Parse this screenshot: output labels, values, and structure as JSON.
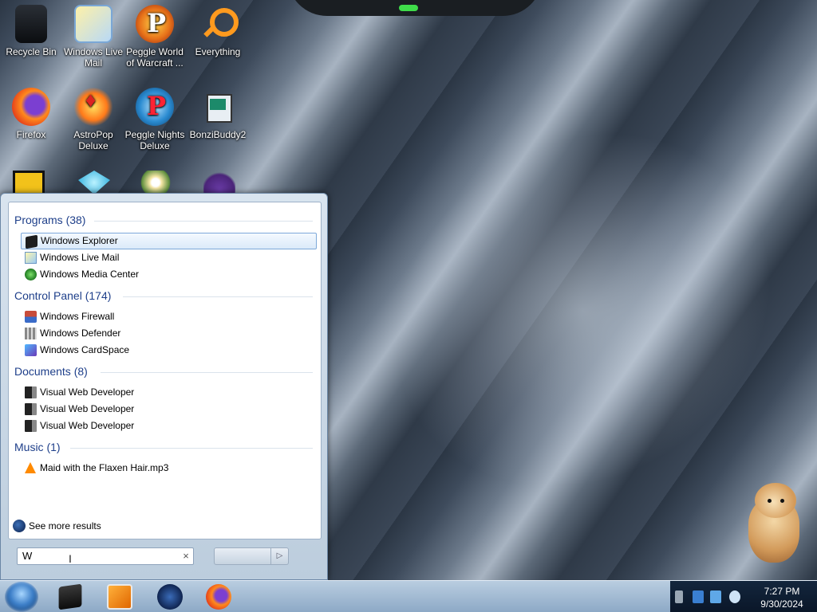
{
  "desktop": {
    "icons": [
      {
        "label": "Recycle Bin",
        "icon": "recycle-bin-icon"
      },
      {
        "label": "Windows Live Mail",
        "icon": "windows-live-mail-icon"
      },
      {
        "label": "Peggle World of Warcraft ...",
        "icon": "peggle-icon"
      },
      {
        "label": "Everything",
        "icon": "magnifier-icon"
      },
      {
        "label": "Firefox",
        "icon": "firefox-icon"
      },
      {
        "label": "AstroPop Deluxe",
        "icon": "astropop-icon"
      },
      {
        "label": "Peggle Nights Deluxe",
        "icon": "peggle-nights-icon"
      },
      {
        "label": "BonziBuddy2",
        "icon": "bonzibuddy-icon"
      }
    ]
  },
  "start_menu": {
    "groups": [
      {
        "title": "Programs (38)",
        "items": [
          {
            "label": "Windows Explorer",
            "icon": "windows-explorer-icon",
            "selected": true
          },
          {
            "label": "Windows Live Mail",
            "icon": "windows-live-mail-icon"
          },
          {
            "label": "Windows Media Center",
            "icon": "windows-media-center-icon"
          }
        ]
      },
      {
        "title": "Control Panel (174)",
        "items": [
          {
            "label": "Windows Firewall",
            "icon": "firewall-icon"
          },
          {
            "label": "Windows Defender",
            "icon": "defender-icon"
          },
          {
            "label": "Windows CardSpace",
            "icon": "cardspace-icon"
          }
        ]
      },
      {
        "title": "Documents (8)",
        "items": [
          {
            "label": "Visual Web Developer",
            "icon": "visual-web-developer-icon"
          },
          {
            "label": "Visual Web Developer",
            "icon": "visual-web-developer-icon"
          },
          {
            "label": "Visual Web Developer",
            "icon": "visual-web-developer-icon"
          }
        ]
      },
      {
        "title": "Music (1)",
        "items": [
          {
            "label": "Maid with the Flaxen Hair.mp3",
            "icon": "vlc-icon"
          }
        ]
      }
    ],
    "see_more": "See more results",
    "search": {
      "value": "W",
      "clear": "×"
    },
    "shutdown_arrow": "▷"
  },
  "taskbar": {
    "apps": [
      "windows-explorer-icon",
      "windows-media-player-icon",
      "bonzibuddy-icon",
      "firefox-icon"
    ],
    "clock": {
      "time": "7:27 PM",
      "date": "9/30/2024"
    }
  },
  "colors": {
    "group_heading": "#1e3f8a",
    "selection_border": "#7ea9d9",
    "taskbar": "#8da9c6"
  }
}
